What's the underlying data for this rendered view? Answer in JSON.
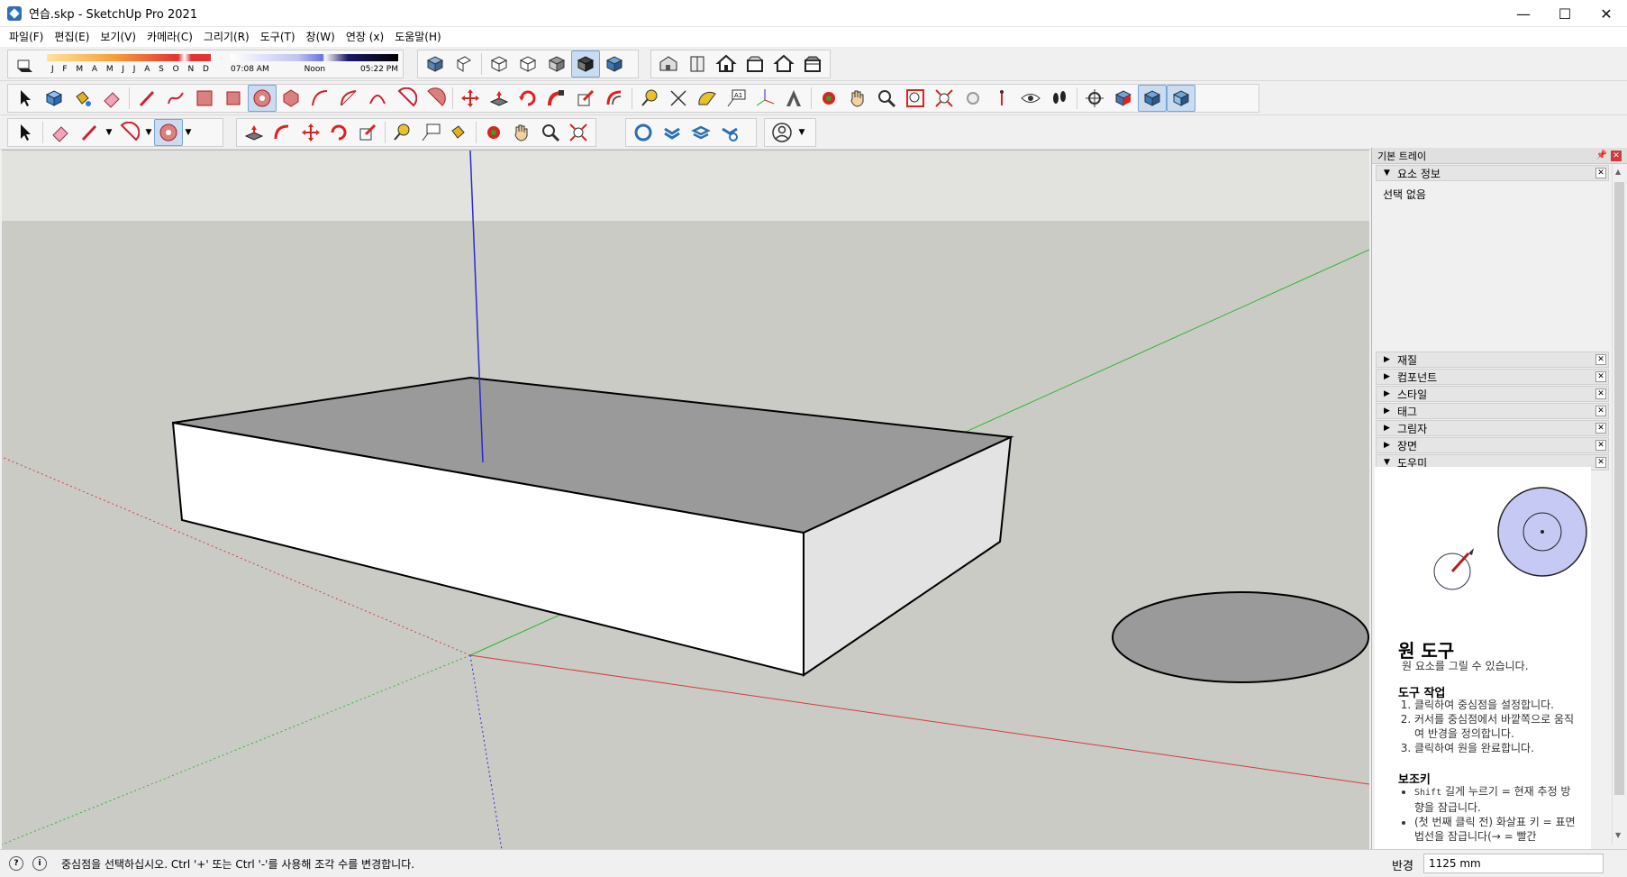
{
  "window": {
    "title": "연습.skp - SketchUp Pro 2021",
    "minimize": "—",
    "maximize": "☐",
    "close": "✕"
  },
  "menu": [
    "파일(F)",
    "편집(E)",
    "보기(V)",
    "카메라(C)",
    "그리기(R)",
    "도구(T)",
    "창(W)",
    "연장 (x)",
    "도움말(H)"
  ],
  "shadow": {
    "months": [
      "J",
      "F",
      "M",
      "A",
      "M",
      "J",
      "J",
      "A",
      "S",
      "O",
      "N",
      "D"
    ],
    "time_start": "07:08 AM",
    "time_mid": "Noon",
    "time_end": "05:22 PM"
  },
  "tray": {
    "title": "기본 트레이",
    "entity_info": {
      "header": "요소 정보",
      "body": "선택 없음"
    },
    "panels": [
      "재질",
      "컴포넌트",
      "스타일",
      "태그",
      "그림자",
      "장면"
    ],
    "instructor_header": "도우미"
  },
  "instructor": {
    "title": "원 도구",
    "subtitle": "원 요소를 그릴 수 있습니다.",
    "ops_header": "도구 작업",
    "ops": [
      "클릭하여 중심점을 설정합니다.",
      "커서를 중심점에서 바깥쪽으로 움직여 반경을 정의합니다.",
      "클릭하여 원을 완료합니다."
    ],
    "keys_header": "보조키",
    "keys": [
      {
        "key": "Shift",
        "text": "길게 누르기 = 현재 추정 방향을 잠급니다."
      },
      {
        "key": "",
        "text": "(첫 번째 클릭 전) 화살표 키 = 표면 법선을 잠급니다(→ = 빨간"
      }
    ]
  },
  "status": {
    "message": "중심점을 선택하십시오. Ctrl '+' 또는 Ctrl '-'를 사용해 조각 수를 변경합니다.",
    "measure_label": "반경",
    "measure_value": "1125 mm"
  },
  "colors": {
    "red_axis": "#d43c3c",
    "green_axis": "#2fb52f",
    "blue_axis": "#2a2ad0",
    "sky": "#e2e2de",
    "ground": "#cbcbc6",
    "top_face": "#9a9a9a",
    "front_face": "#ffffff",
    "side_face": "#e3e3e3"
  }
}
